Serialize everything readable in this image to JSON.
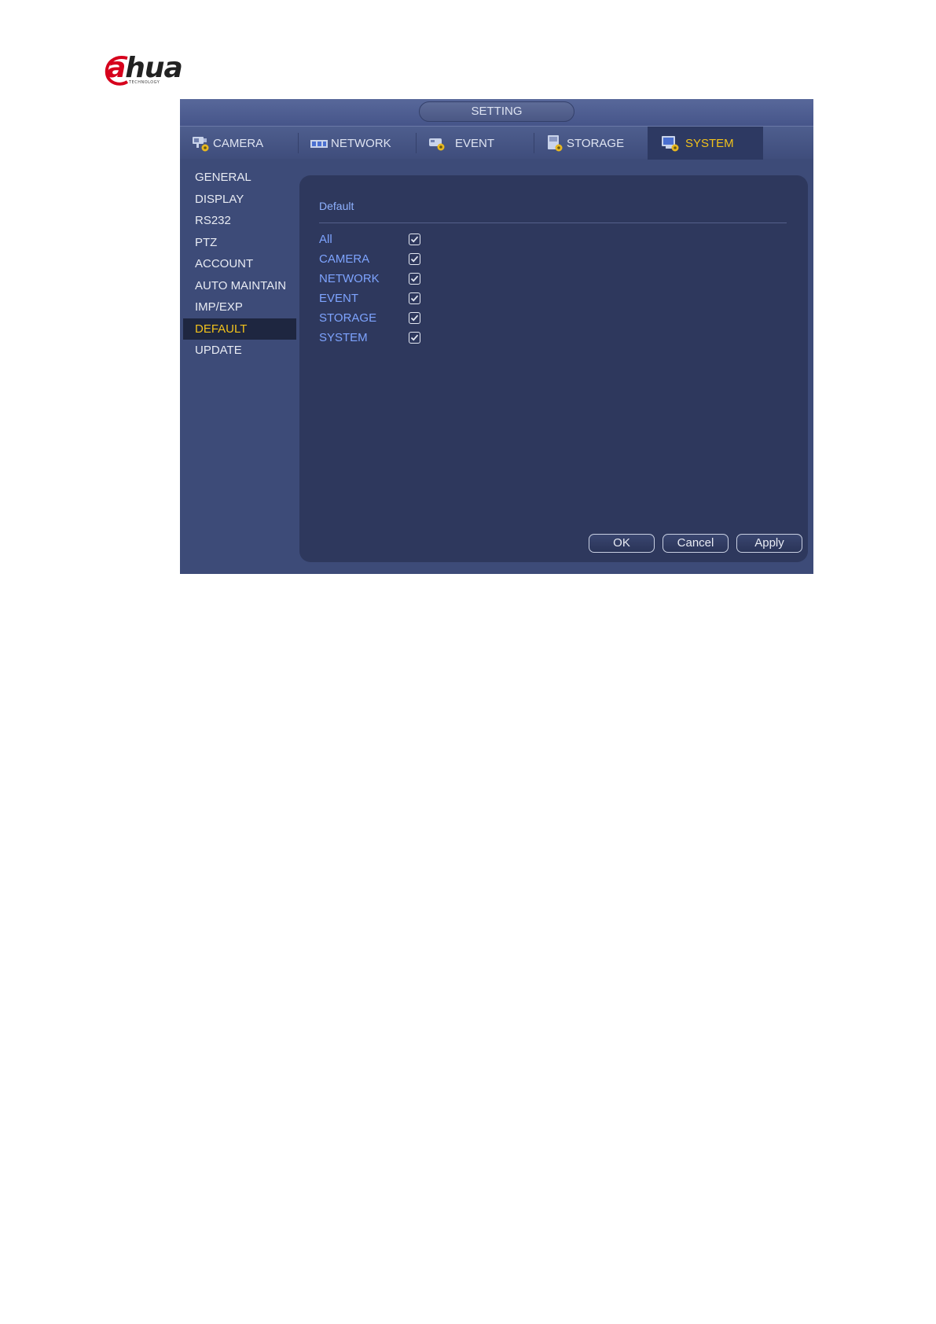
{
  "brand": {
    "logo_text_a": "a",
    "logo_text_rest": "hua",
    "logo_subtext": "TECHNOLOGY",
    "accent_color": "#d6001c"
  },
  "window": {
    "title": "SETTING"
  },
  "tabs": [
    {
      "label": "CAMERA",
      "icon": "camera-settings-icon",
      "active": false
    },
    {
      "label": "NETWORK",
      "icon": "network-icon",
      "active": false
    },
    {
      "label": "EVENT",
      "icon": "event-icon",
      "active": false
    },
    {
      "label": "STORAGE",
      "icon": "storage-icon",
      "active": false
    },
    {
      "label": "SYSTEM",
      "icon": "system-icon",
      "active": true
    }
  ],
  "sidebar": {
    "items": [
      {
        "label": "GENERAL",
        "active": false
      },
      {
        "label": "DISPLAY",
        "active": false
      },
      {
        "label": "RS232",
        "active": false
      },
      {
        "label": "PTZ",
        "active": false
      },
      {
        "label": "ACCOUNT",
        "active": false
      },
      {
        "label": "AUTO MAINTAIN",
        "active": false
      },
      {
        "label": "IMP/EXP",
        "active": false
      },
      {
        "label": "DEFAULT",
        "active": true
      },
      {
        "label": "UPDATE",
        "active": false
      }
    ]
  },
  "content": {
    "section_title": "Default",
    "options": [
      {
        "label": "All",
        "checked": true
      },
      {
        "label": "CAMERA",
        "checked": true
      },
      {
        "label": "NETWORK",
        "checked": true
      },
      {
        "label": "EVENT",
        "checked": true
      },
      {
        "label": "STORAGE",
        "checked": true
      },
      {
        "label": "SYSTEM",
        "checked": true
      }
    ]
  },
  "buttons": {
    "ok": "OK",
    "cancel": "Cancel",
    "apply": "Apply"
  },
  "colors": {
    "active_text": "#f2c21b",
    "option_text": "#7ea4ff",
    "window_bg": "#3d4b78",
    "panel_bg": "#2e385d"
  }
}
